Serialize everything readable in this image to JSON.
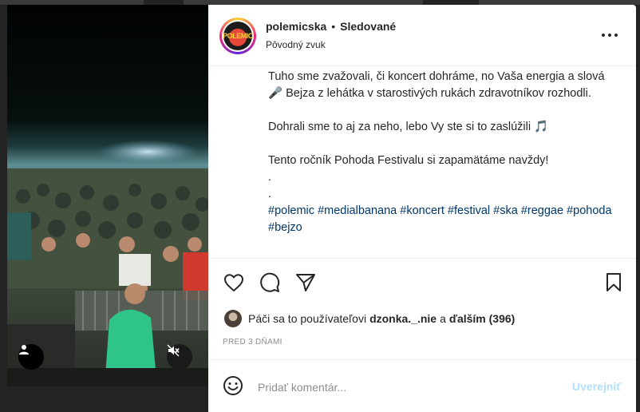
{
  "header": {
    "username": "polemicska",
    "separator": "•",
    "follow_status": "Sledované",
    "audio": "Pôvodný zvuk",
    "avatar_text": "POLEMIC",
    "more_icon": "more-horizontal-icon"
  },
  "caption": {
    "line1": "Tuho sme zvažovali, či koncert dohráme, no Vaša energia a slová 🎤 Bejza z lehátka v starostivých rukách zdravotníkov rozhodli.",
    "line2": "Dohrali sme to aj za neho, lebo Vy ste si to zaslúžili 🎵",
    "line3": "Tento ročník Pohoda Festivalu si zapamätáme navždy!",
    "dot1": ".",
    "dot2": ".",
    "hashtags": [
      "#polemic",
      "#medialbanana",
      "#koncert",
      "#festival",
      "#ska",
      "#reggae",
      "#pohoda",
      "#bejzo"
    ]
  },
  "actions": {
    "like_icon": "heart-icon",
    "comment_icon": "comment-icon",
    "share_icon": "send-icon",
    "save_icon": "bookmark-icon"
  },
  "likes": {
    "prefix": "Páči sa to používateľovi",
    "user": "dzonka._.nie",
    "middle": "a",
    "others": "ďalším (396)"
  },
  "date": "PRED 3 DŇAMI",
  "comment": {
    "placeholder": "Pridať komentár...",
    "post_label": "Uverejniť"
  },
  "colors": {
    "link": "#00376b",
    "post_disabled": "#b2dffc",
    "muted": "#8e8e8e"
  }
}
